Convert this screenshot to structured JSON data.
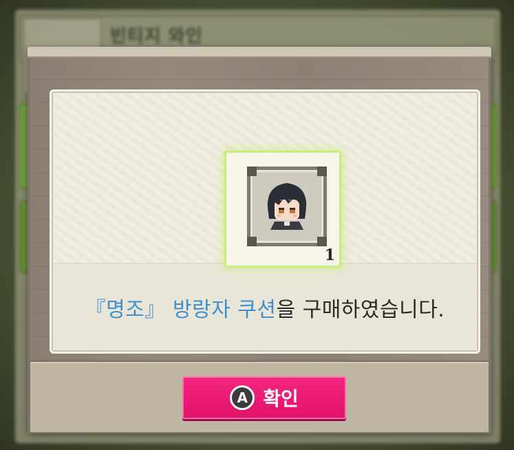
{
  "background": {
    "title": "빈티지 와인"
  },
  "item": {
    "icon": "dark-haired-character-cushion-icon",
    "count": "1"
  },
  "message": {
    "item_name": "『명조』 방랑자 쿠션",
    "suffix": "을 구매하였습니다."
  },
  "confirm": {
    "key": "A",
    "label": "확인"
  },
  "colors": {
    "highlight": "#3f8fd0",
    "confirm_button": "#e3136c",
    "slot_glow": "#c9ec7a"
  }
}
